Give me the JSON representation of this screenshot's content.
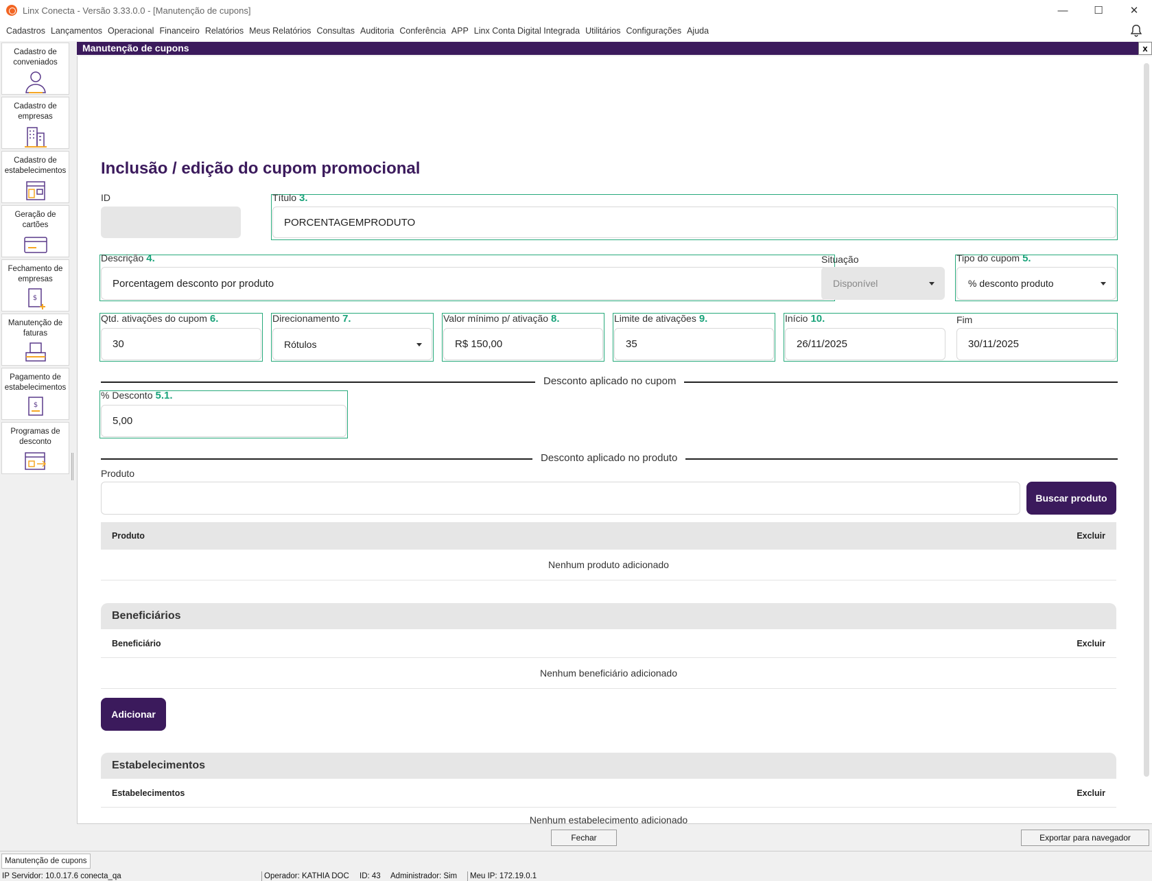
{
  "window": {
    "title": "Linx Conecta - Versão 3.33.0.0 - [Manutenção de cupons]",
    "minimize": "—",
    "maximize": "☐",
    "close": "✕"
  },
  "menu": [
    "Cadastros",
    "Lançamentos",
    "Operacional",
    "Financeiro",
    "Relatórios",
    "Meus Relatórios",
    "Consultas",
    "Auditoria",
    "Conferência",
    "APP",
    "Linx Conta Digital Integrada",
    "Utilitários",
    "Configurações",
    "Ajuda"
  ],
  "sidebar": [
    {
      "label": "Cadastro de conveniados",
      "icon": "user-icon"
    },
    {
      "label": "Cadastro de empresas",
      "icon": "building-icon"
    },
    {
      "label": "Cadastro de estabelecimentos",
      "icon": "store-icon"
    },
    {
      "label": "Geração de cartões",
      "icon": "card-icon"
    },
    {
      "label": "Fechamento de empresas",
      "icon": "invoice-add-icon"
    },
    {
      "label": "Manutenção de faturas",
      "icon": "tray-icon"
    },
    {
      "label": "Pagamento de estabelecimentos",
      "icon": "payment-icon"
    },
    {
      "label": "Programas de desconto",
      "icon": "discount-program-icon"
    }
  ],
  "panel": {
    "title": "Manutenção de cupons",
    "close": "x"
  },
  "form": {
    "heading": "Inclusão / edição do cupom promocional",
    "id": {
      "label": "ID",
      "value": ""
    },
    "titulo": {
      "label": "Título",
      "num": "3.",
      "value": "PORCENTAGEMPRODUTO"
    },
    "descricao": {
      "label": "Descrição",
      "num": "4.",
      "value": "Porcentagem desconto por produto"
    },
    "situacao": {
      "label": "Situação",
      "value": "Disponível"
    },
    "tipo": {
      "label": "Tipo do cupom",
      "num": "5.",
      "value": "% desconto produto"
    },
    "qtd": {
      "label": "Qtd. ativações do cupom",
      "num": "6.",
      "value": "30"
    },
    "direcionamento": {
      "label": "Direcionamento",
      "num": "7.",
      "value": "Rótulos"
    },
    "valor_minimo": {
      "label": "Valor mínimo p/ ativação",
      "num": "8.",
      "value": "R$ 150,00"
    },
    "limite": {
      "label": "Limite de ativações",
      "num": "9.",
      "value": "35"
    },
    "inicio": {
      "label": "Início",
      "num": "10.",
      "value": "26/11/2025"
    },
    "fim": {
      "label": "Fim",
      "value": "30/11/2025"
    },
    "desconto_cupom_divider": "Desconto aplicado no cupom",
    "desconto": {
      "label": "% Desconto",
      "num": "5.1.",
      "value": "5,00"
    },
    "desconto_produto_divider": "Desconto aplicado no produto",
    "produto": {
      "label": "Produto",
      "value": "",
      "button": "Buscar produto"
    },
    "produtos_table": {
      "col1": "Produto",
      "col2": "Excluir",
      "empty": "Nenhum produto adicionado"
    },
    "beneficiarios": {
      "title": "Beneficiários",
      "col1": "Beneficiário",
      "col2": "Excluir",
      "empty": "Nenhum beneficiário adicionado",
      "button": "Adicionar"
    },
    "estabelecimentos": {
      "title": "Estabelecimentos",
      "col1": "Estabelecimentos",
      "col2": "Excluir",
      "empty": "Nenhum estabelecimento adicionado"
    }
  },
  "footer": {
    "close": "Fechar",
    "export": "Exportar para navegador"
  },
  "taskbar": {
    "tab": "Manutenção de cupons"
  },
  "status": {
    "server": "IP Servidor: 10.0.17.6 conecta_qa",
    "operator": "Operador: KATHIA DOC",
    "id": "ID: 43",
    "admin": "Administrador: Sim",
    "ip": "Meu IP: 172.19.0.1"
  },
  "colors": {
    "brand": "#3b1a5c",
    "highlight": "#26a97a"
  }
}
